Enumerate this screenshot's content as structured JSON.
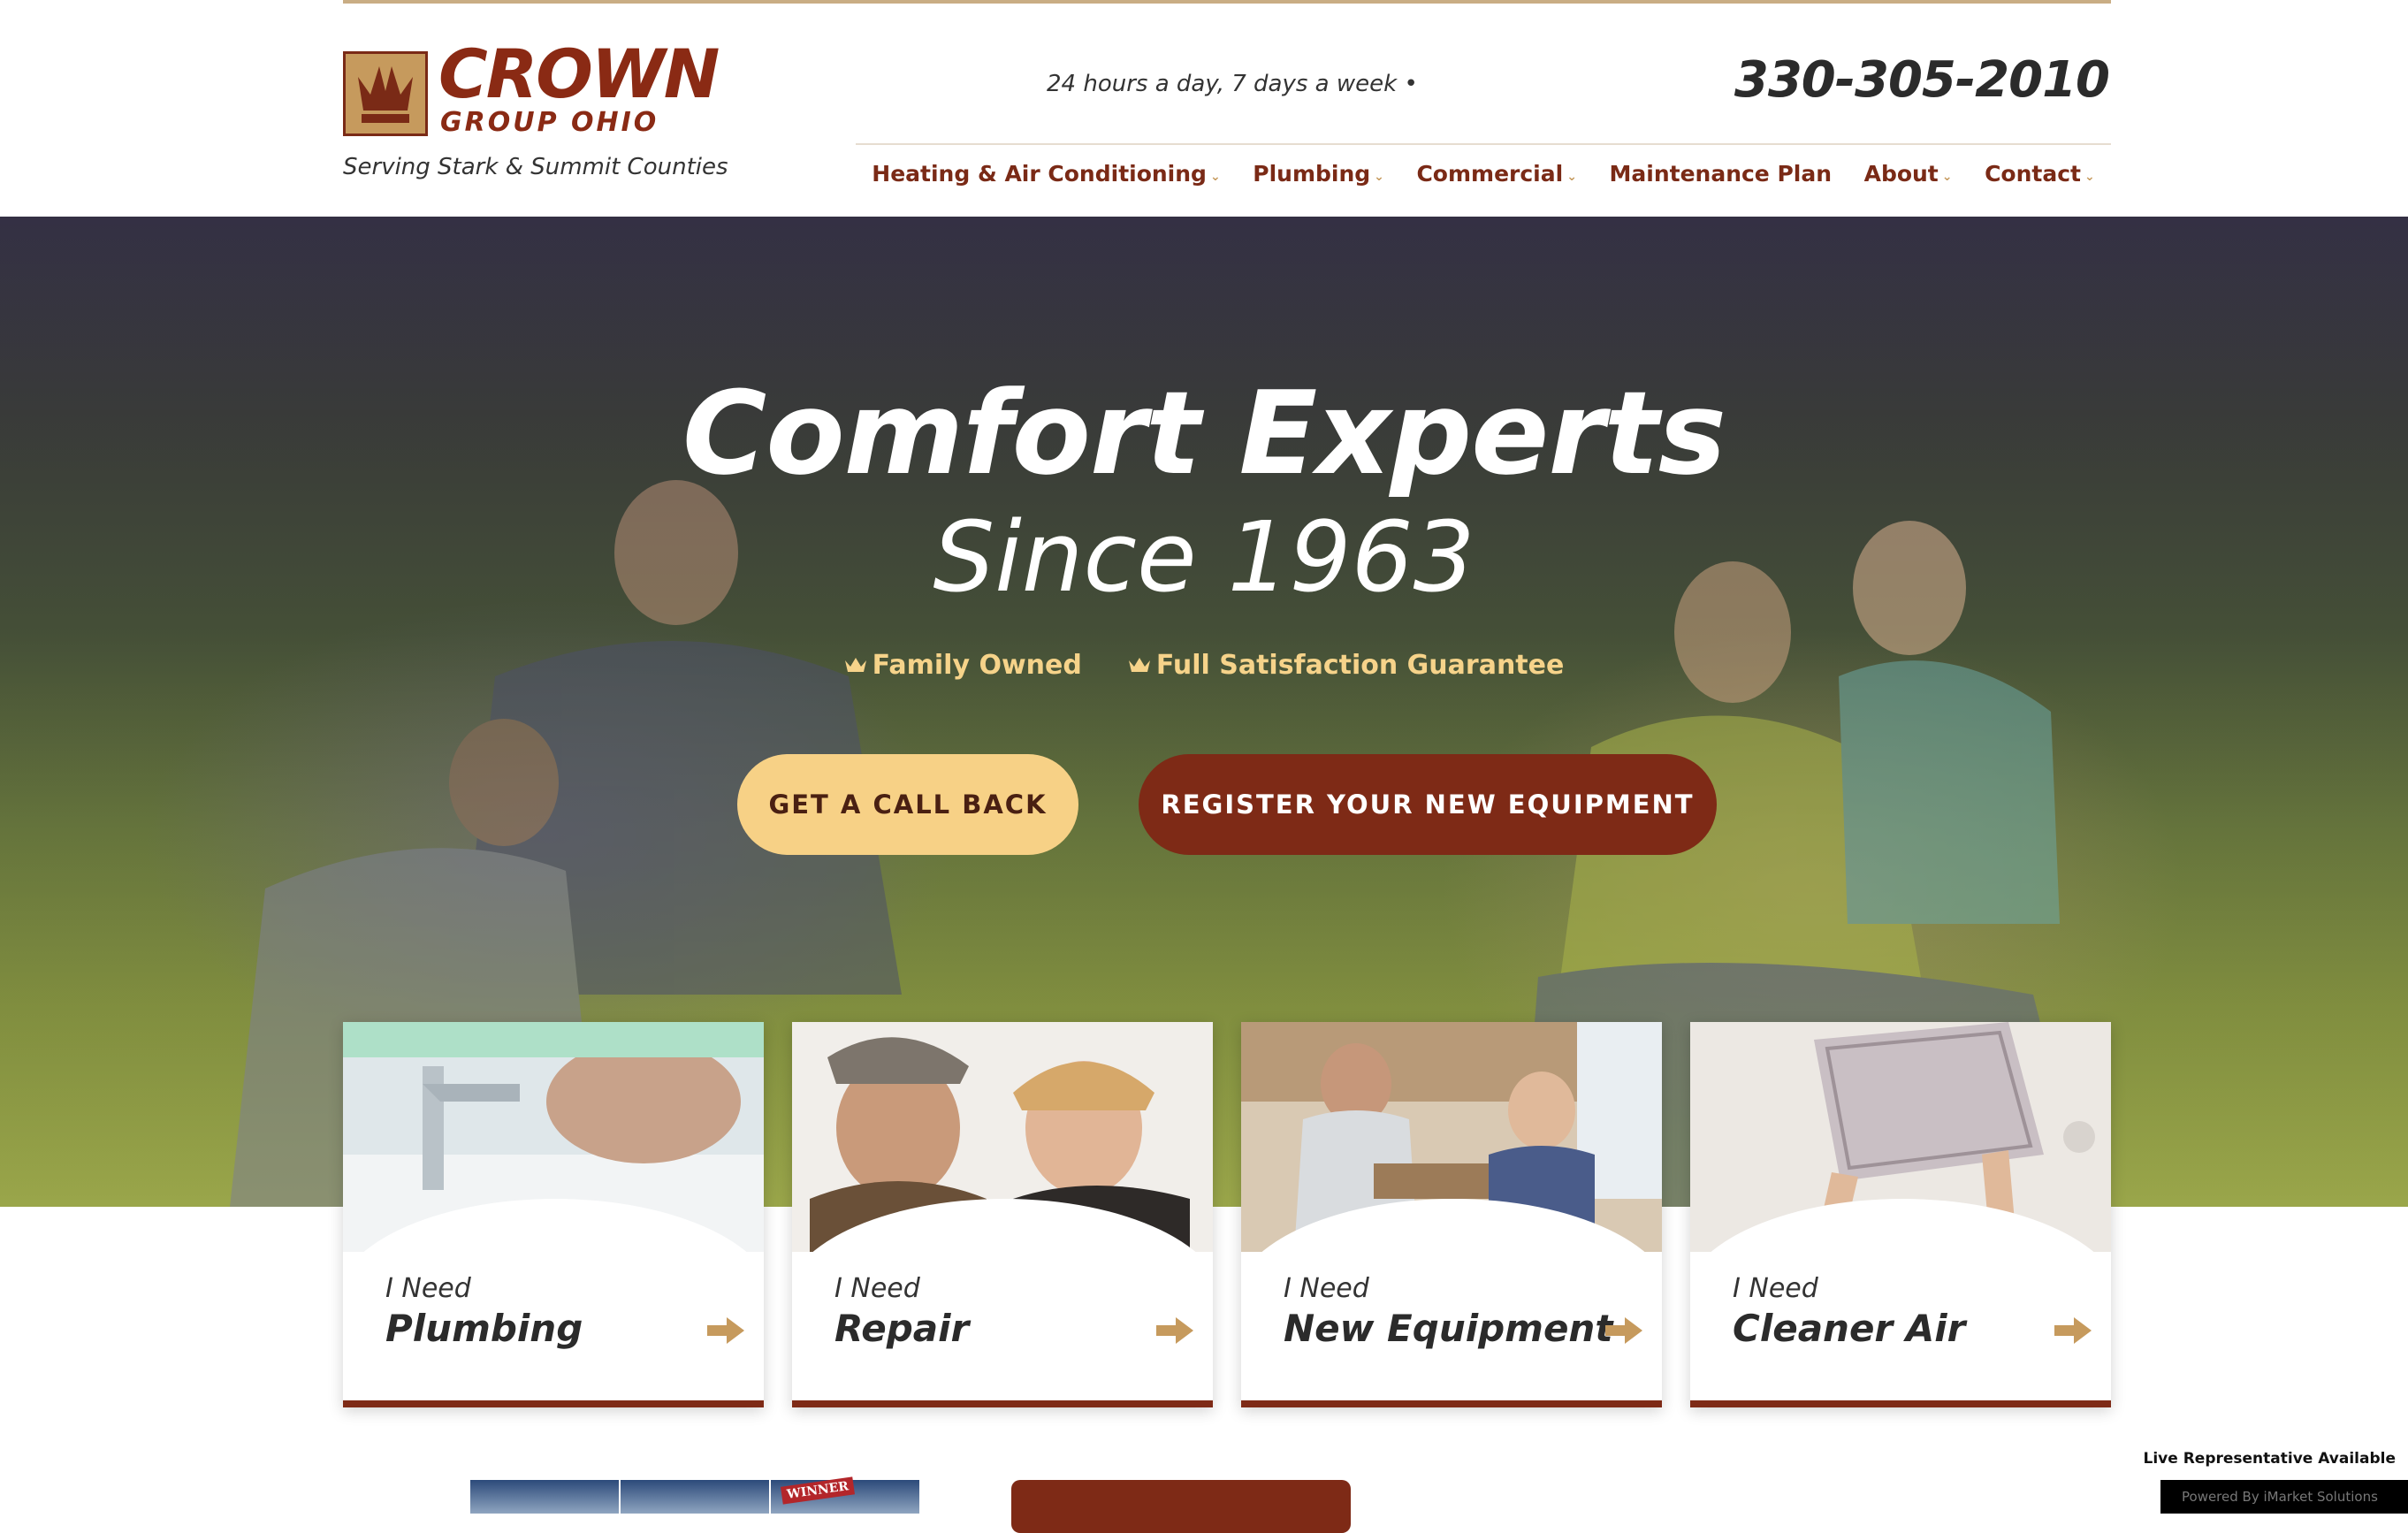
{
  "header": {
    "logo_word": "CROWN",
    "logo_sub": "GROUP OHIO",
    "tagline": "Serving Stark & Summit Counties",
    "hours": "24 hours a day, 7 days a week •",
    "phone": "330-305-2010"
  },
  "nav": {
    "items": [
      {
        "label": "Heating & Air Conditioning",
        "dropdown": true
      },
      {
        "label": "Plumbing",
        "dropdown": true
      },
      {
        "label": "Commercial",
        "dropdown": true
      },
      {
        "label": "Maintenance Plan",
        "dropdown": false
      },
      {
        "label": "About",
        "dropdown": true
      },
      {
        "label": "Contact",
        "dropdown": true
      }
    ]
  },
  "hero": {
    "title": "Comfort Experts",
    "subtitle": "Since 1963",
    "badges": [
      "Family Owned",
      "Full Satisfaction Guarantee"
    ],
    "cta_primary": "GET A CALL BACK",
    "cta_secondary": "REGISTER YOUR NEW EQUIPMENT"
  },
  "cards": [
    {
      "prefix": "I Need",
      "title": "Plumbing"
    },
    {
      "prefix": "I Need",
      "title": "Repair"
    },
    {
      "prefix": "I Need",
      "title": "New Equipment"
    },
    {
      "prefix": "I Need",
      "title": "Cleaner Air"
    }
  ],
  "footer_strip": {
    "award_badge": "WINNER",
    "chat_status": "Live Representative Available",
    "chat_powered": "Powered By iMarket Solutions"
  },
  "colors": {
    "brand_red": "#7e2a16",
    "brand_gold": "#c69a5d",
    "cta_yellow": "#f7d186",
    "badge_text": "#f6d38a"
  },
  "icons": {
    "logo": "crown-icon",
    "badge": "crown-icon",
    "card_action": "arrow-right-icon",
    "nav_dropdown": "chevron-down-icon"
  }
}
